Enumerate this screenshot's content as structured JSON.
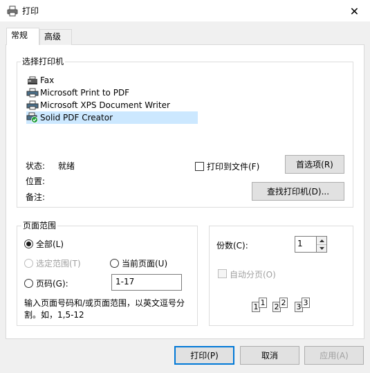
{
  "window": {
    "title": "打印",
    "close_glyph": "✕"
  },
  "tabs": [
    {
      "label": "常规",
      "active": true
    },
    {
      "label": "高级",
      "active": false
    }
  ],
  "printer_group": {
    "title": "选择打印机",
    "printers": [
      {
        "name": "Fax",
        "icon": "fax-printer-icon"
      },
      {
        "name": "Microsoft Print to PDF",
        "icon": "printer-icon"
      },
      {
        "name": "Microsoft XPS Document Writer",
        "icon": "printer-icon"
      },
      {
        "name": "Solid PDF Creator",
        "icon": "default-printer-icon",
        "selected": true
      }
    ],
    "status_label": "状态:",
    "status_value": "就绪",
    "location_label": "位置:",
    "comment_label": "备注:",
    "print_to_file_label": "打印到文件(F)",
    "preferences_button": "首选项(R)",
    "find_printer_button": "查找打印机(D)..."
  },
  "range_group": {
    "title": "页面范围",
    "all_label": "全部(L)",
    "selection_label": "选定范围(T)",
    "current_page_label": "当前页面(U)",
    "pages_label": "页码(G):",
    "pages_value": "1-17",
    "hint": "输入页面号码和/或页面范围，以英文逗号分割。如，1,5-12",
    "selected_option": "all"
  },
  "copies_group": {
    "copies_label": "份数(C):",
    "copies_value": "1",
    "collate_label": "自动分页(O)",
    "collate_sheets": [
      "1",
      "1",
      "2",
      "2",
      "3",
      "3"
    ]
  },
  "footer": {
    "print_button": "打印(P)",
    "cancel_button": "取消",
    "apply_button": "应用(A)"
  },
  "colors": {
    "selection": "#cce8ff",
    "accent": "#0078d7",
    "dialog_bg": "#f0f0f0"
  }
}
